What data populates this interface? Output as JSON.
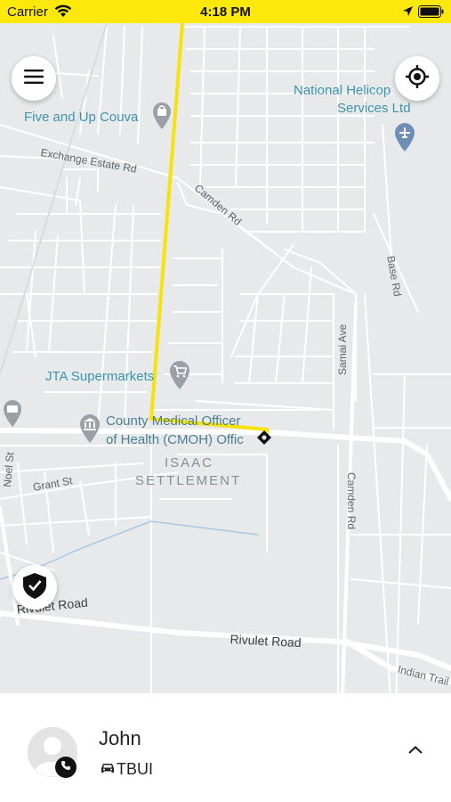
{
  "status_bar": {
    "carrier": "Carrier",
    "time": "4:18 PM"
  },
  "map": {
    "poi_labels": {
      "five_and_up": "Five and Up Couva",
      "national_heli_1": "National Helicop",
      "national_heli_2": "Services Ltd",
      "jta": "JTA Supermarkets",
      "county_medical_1": "County Medical Officer",
      "county_medical_2": "of Health (CMOH) Offic"
    },
    "street_labels": {
      "exchange_estate": "Exchange Estate Rd",
      "camden_rd_top": "Camden Rd",
      "base_rd": "Base Rd",
      "samai_ave": "Samai Ave",
      "camden_rd_right": "Camden Rd",
      "noel_st": "Noel St",
      "grant_st": "Grant St",
      "rivulet_left": "Rivulet Road",
      "rivulet_right": "Rivulet Road",
      "indian_trail": "Indian Trail"
    },
    "area_labels": {
      "isaac": "ISAAC",
      "settlement": "SETTLEMENT"
    },
    "icons": {
      "menu": "menu-icon",
      "my_location": "crosshair-icon",
      "safety": "shield-check-icon",
      "destination": "diamond-marker-icon",
      "route_color": "#f7e20a"
    }
  },
  "driver": {
    "name": "John",
    "vehicle": "TBUI"
  }
}
